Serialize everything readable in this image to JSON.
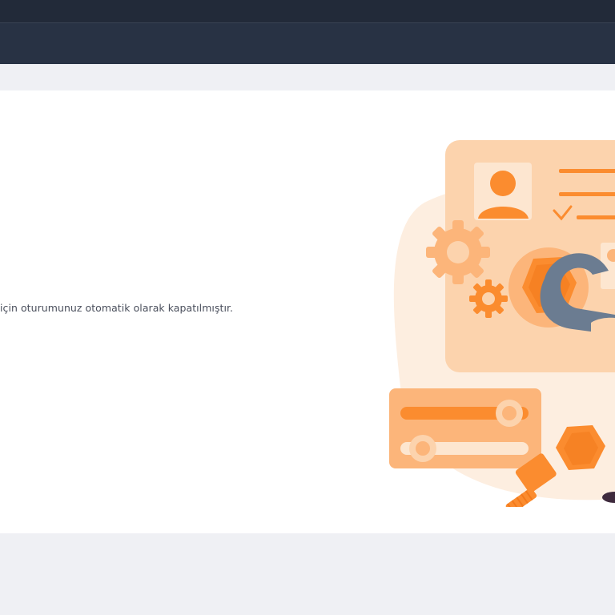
{
  "message": {
    "text": "için oturumunuz otomatik olarak kapatılmıştır."
  },
  "illustration": {
    "icon": "maintenance-illustration",
    "accent_color": "#fb8c2f",
    "light_color": "#fdc9a0",
    "wrench_color": "#6b7c91"
  },
  "colors": {
    "topbar": "#222a39",
    "navbar": "#283244",
    "background": "#eff0f4",
    "card": "#ffffff"
  }
}
